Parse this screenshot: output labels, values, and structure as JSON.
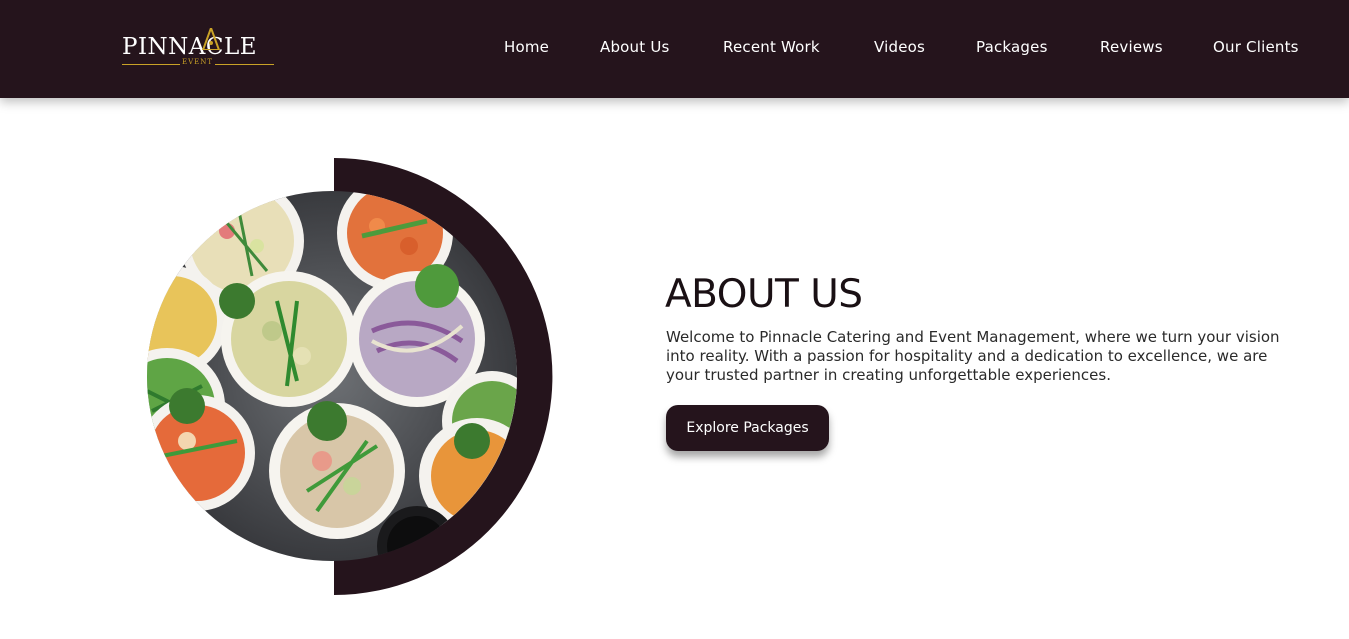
{
  "brand": {
    "logo_text": "PINNACLE",
    "logo_subtext": "EVENT",
    "logo_accent_color": "#c9a227",
    "nav_background": "#25141c"
  },
  "nav": {
    "items": [
      {
        "label": "Home"
      },
      {
        "label": "About Us"
      },
      {
        "label": "Recent Work"
      },
      {
        "label": "Videos"
      },
      {
        "label": "Packages"
      },
      {
        "label": "Reviews"
      },
      {
        "label": "Our Clients"
      }
    ]
  },
  "about": {
    "title": "ABOUT US",
    "body": "Welcome to Pinnacle Catering and Event Management, where we turn your vision into reality. With a passion for hospitality and a dedication to excellence, we are your trusted partner in creating unforgettable experiences.",
    "cta_label": "Explore Packages"
  },
  "hero_image": {
    "subject": "overhead view of salad bowls"
  }
}
